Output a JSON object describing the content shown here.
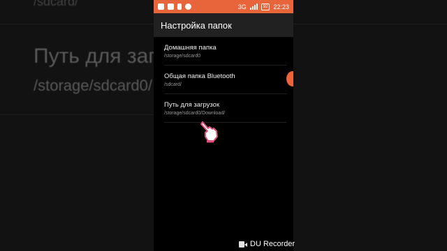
{
  "background": {
    "top_fragment": "/sdcard/",
    "title": "Путь для загру",
    "subtitle": "/storage/sdcard0/"
  },
  "status_bar": {
    "network": "3G",
    "battery": "92",
    "time": "22:23",
    "accent_color": "#e8643a"
  },
  "app_bar": {
    "title": "Настройка папок"
  },
  "items": [
    {
      "title": "Домашняя папка",
      "path": "/storage/sdcard0"
    },
    {
      "title": "Общая папка Bluetooth",
      "path": "/sdcard/"
    },
    {
      "title": "Путь для загрузок",
      "path": "/storage/sdcard0/Download/"
    }
  ],
  "watermark": {
    "label": "DU Recorder",
    "icon": "video-camera-icon"
  },
  "touch_indicator": {
    "icon": "pointing-hand-icon"
  }
}
